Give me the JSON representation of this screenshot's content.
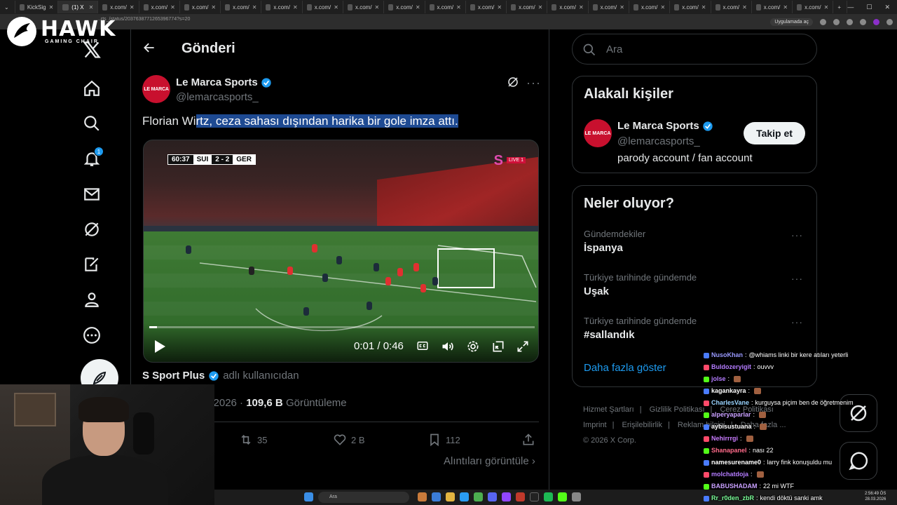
{
  "browser": {
    "tabs": [
      {
        "label": "KickSig"
      },
      {
        "label": "(1) X"
      },
      {
        "label": "x.com/"
      },
      {
        "label": "x.com/"
      },
      {
        "label": "x.com/"
      },
      {
        "label": "x.com/"
      },
      {
        "label": "x.com/"
      },
      {
        "label": "x.com/"
      },
      {
        "label": "x.com/"
      },
      {
        "label": "x.com/"
      },
      {
        "label": "x.com/"
      },
      {
        "label": "x.com/"
      },
      {
        "label": "x.com/"
      },
      {
        "label": "x.com/"
      },
      {
        "label": "x.com/"
      },
      {
        "label": "x.com/"
      },
      {
        "label": "x.com/"
      },
      {
        "label": "x.com/"
      },
      {
        "label": "x.com/"
      },
      {
        "label": "x.com/"
      }
    ],
    "url": "..rts_/status/2037638771265396774?s=20",
    "app_button": "Uygulamada aç"
  },
  "overlay_logo": {
    "name": "HAWK",
    "sub": "GAMING CHAIR"
  },
  "nav": {
    "items": [
      {
        "icon": "home-icon"
      },
      {
        "icon": "search-icon"
      },
      {
        "icon": "bell-icon",
        "badge": "1"
      },
      {
        "icon": "mail-icon"
      },
      {
        "icon": "grok-icon"
      },
      {
        "icon": "compose-icon"
      },
      {
        "icon": "profile-icon"
      },
      {
        "icon": "more-icon"
      }
    ]
  },
  "main": {
    "title": "Gönderi",
    "tweet": {
      "author_name": "Le Marca Sports",
      "author_handle": "@lemarcasports_",
      "avatar_text": "LE MARCA",
      "text_plain": "Florian Wi",
      "text_highlighted": "rtz, ceza sahası dışından harika bir gole imza attı.",
      "video": {
        "clock": "60:37",
        "home": "SUI",
        "score": "2 - 2",
        "away": "GER",
        "live_label": "LIVE 1",
        "channel_logo": "S",
        "time_display": "0:01 / 0:46",
        "progress": 0.02
      },
      "source_name": "S Sport Plus",
      "source_suffix": "adlı kullanıcıdan",
      "date_fragment": "ar 2026 ·",
      "views_value": "109,6 B",
      "views_label": "Görüntüleme",
      "retweets": "35",
      "likes": "2 B",
      "bookmarks": "112",
      "quotes_link": "Alıntıları görüntüle"
    }
  },
  "right": {
    "search_placeholder": "Ara",
    "related": {
      "title": "Alakalı kişiler",
      "name": "Le Marca Sports",
      "handle": "@lemarcasports_",
      "bio": "parody account / fan account",
      "follow_label": "Takip et",
      "avatar_text": "LE MARCA"
    },
    "trends": {
      "title": "Neler oluyor?",
      "items": [
        {
          "context": "Gündemdekiler",
          "name": "İspanya"
        },
        {
          "context": "Türkiye tarihinde gündemde",
          "name": "Uşak"
        },
        {
          "context": "Türkiye tarihinde gündemde",
          "name": "#sallandık"
        }
      ],
      "show_more": "Daha fazla göster"
    },
    "footer": {
      "links": [
        "Hizmet Şartları",
        "Gizlilik Politikası",
        "Çerez Politikası",
        "Imprint",
        "Erişilebilirlik",
        "Reklam bilgisi",
        "Daha fazla ..."
      ],
      "copyright": "© 2026 X Corp."
    }
  },
  "chat": {
    "messages": [
      {
        "user": "NusoKhan",
        "msg": "@whiams linki bir kere atıları yeterli",
        "color": "#9a9aff"
      },
      {
        "user": "Buldozeryigit",
        "msg": "ouvvv",
        "color": "#b47cff"
      },
      {
        "user": "jolse",
        "msg": "",
        "color": "#b47cff"
      },
      {
        "user": "kagankayra",
        "msg": "",
        "color": "#ffffff"
      },
      {
        "user": "CharlesVane",
        "msg": "kurguysa piçim ben de öğretmenim",
        "color": "#9ad4ff"
      },
      {
        "user": "alperyaparlar",
        "msg": "",
        "color": "#c9a0ff"
      },
      {
        "user": "aybisustuana",
        "msg": "",
        "color": "#ffffff"
      },
      {
        "user": "Nehirrrgi",
        "msg": "",
        "color": "#c97cff"
      },
      {
        "user": "Shanapanel",
        "msg": "nası 22",
        "color": "#ff6b8a"
      },
      {
        "user": "namesurename0",
        "msg": "larry fink konuşuldu mu",
        "color": "#ffffff"
      },
      {
        "user": "molchatdoja",
        "msg": "",
        "color": "#b47cff"
      },
      {
        "user": "BABUSHADAM",
        "msg": "22 mi WTF",
        "color": "#c9a0ff"
      },
      {
        "user": "Rr_r0den_zbR",
        "msg": "kendi döktü sanki amk",
        "color": "#7cff9a"
      }
    ]
  },
  "taskbar": {
    "search_placeholder": "Ara",
    "time": "2:56:49 ÖS",
    "date": "28.03.2026"
  }
}
